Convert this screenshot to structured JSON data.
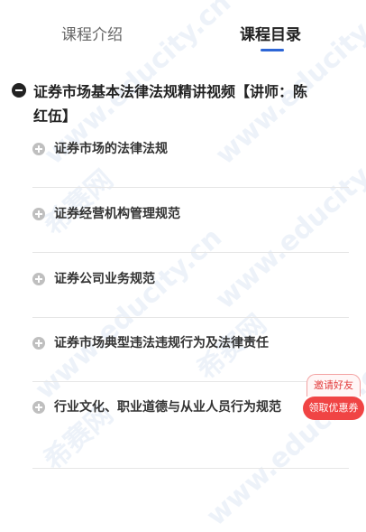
{
  "tabs": {
    "intro_label": "课程介绍",
    "catalog_label": "课程目录"
  },
  "chapter": {
    "title": "证券市场基本法律法规精讲视频【讲师：陈红伍】"
  },
  "sections": [
    "证券市场的法律法规",
    "证券经营机构管理规范",
    "证券公司业务规范",
    "证券市场典型违法违规行为及法律责任",
    "行业文化、职业道德与从业人员行为规范"
  ],
  "watermark": {
    "brand_cn": "希赛网",
    "domain": "www.educity.cn"
  },
  "promo": {
    "invite_label": "邀请好友",
    "coupon_label": "领取优惠券"
  },
  "colors": {
    "accent_blue": "#2d66d6",
    "promo_red": "#f04444"
  }
}
